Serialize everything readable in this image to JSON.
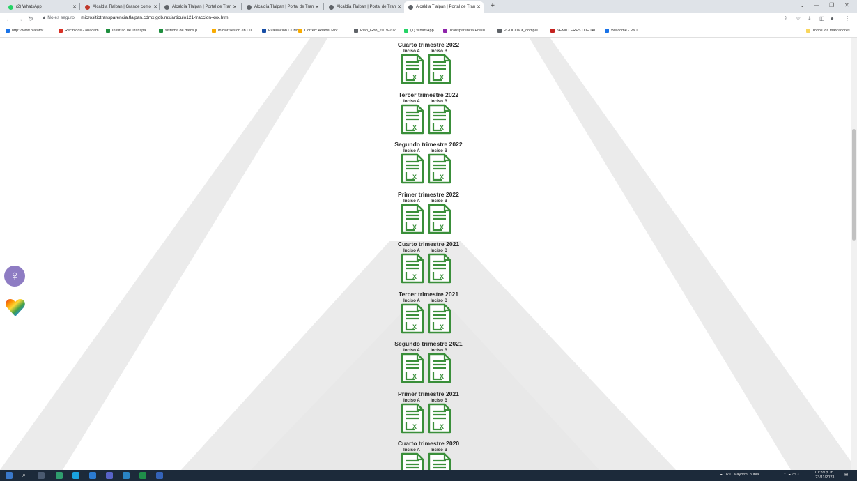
{
  "browser": {
    "tabs": [
      {
        "label": "(2) WhatsApp",
        "color": "#25d366",
        "active": false
      },
      {
        "label": "Alcaldía Tlalpan | Grande como",
        "color": "#c0392b",
        "active": false
      },
      {
        "label": "Alcaldía Tlalpan | Portal de Tran",
        "color": "#5f6368",
        "active": false
      },
      {
        "label": "Alcaldía Tlalpan | Portal de Tran",
        "color": "#5f6368",
        "active": false
      },
      {
        "label": "Alcaldía Tlalpan | Portal de Tran",
        "color": "#5f6368",
        "active": false
      },
      {
        "label": "Alcaldía Tlalpan | Portal de Tran",
        "color": "#5f6368",
        "active": true
      }
    ],
    "new_tab": "+",
    "security": "No es seguro",
    "url": "micrositiotransparencia.tlalpan.cdmx.gob.mx/articulo121-fraccion-xxx.html",
    "bookmarks": [
      {
        "label": "http://www.platafor...",
        "color": "#1a73e8"
      },
      {
        "label": "Recibidos - anacam...",
        "color": "#d93025"
      },
      {
        "label": "Instituto de Transpa...",
        "color": "#1e8e3e"
      },
      {
        "label": "sistema de datos p...",
        "color": "#1e8e3e"
      },
      {
        "label": "Iniciar sesión en Cu...",
        "color": "#f9ab00"
      },
      {
        "label": "Evaluación CDMx",
        "color": "#174ea6"
      },
      {
        "label": "Correo: Anabel Mor...",
        "color": "#f9ab00"
      },
      {
        "label": "Plan_Gob_2019-202...",
        "color": "#5f6368"
      },
      {
        "label": "(1) WhatsApp",
        "color": "#25d366"
      },
      {
        "label": "Transparencia Presu...",
        "color": "#8e24aa"
      },
      {
        "label": "PGDCDMX_comple...",
        "color": "#5f6368"
      },
      {
        "label": "SEMILLERES DIGITAL",
        "color": "#c5221f"
      },
      {
        "label": "Welcome - PNT",
        "color": "#1a73e8"
      }
    ],
    "all_bookmarks": "Todos los marcadores"
  },
  "page": {
    "groups": [
      {
        "title": "Cuarto trimestre 2022",
        "inciso_a": "Inciso A",
        "inciso_b": "Inciso B"
      },
      {
        "title": "Tercer trimestre 2022",
        "inciso_a": "Inciso A",
        "inciso_b": "Inciso B"
      },
      {
        "title": "Segundo trimestre 2022",
        "inciso_a": "Inciso A",
        "inciso_b": "Inciso B"
      },
      {
        "title": "Primer trimestre 2022",
        "inciso_a": "Inciso A",
        "inciso_b": "Inciso B"
      },
      {
        "title": "Cuarto trimestre 2021",
        "inciso_a": "Inciso A",
        "inciso_b": "Inciso B"
      },
      {
        "title": "Tercer trimestre 2021",
        "inciso_a": "Inciso A",
        "inciso_b": "Inciso B"
      },
      {
        "title": "Segundo trimestre 2021",
        "inciso_a": "Inciso A",
        "inciso_b": "Inciso B"
      },
      {
        "title": "Primer trimestre 2021",
        "inciso_a": "Inciso A",
        "inciso_b": "Inciso B"
      },
      {
        "title": "Cuarto trimestre 2020",
        "inciso_a": "Inciso A",
        "inciso_b": "Inciso B"
      }
    ],
    "file_icon": "excel-file-icon",
    "icon_color": "#3a8f3a",
    "side_icons": [
      "venus-symbol-icon",
      "rainbow-heart-icon"
    ]
  },
  "taskbar": {
    "weather": "16°C Mayorm. nubla...",
    "time": "01:39 p. m.",
    "date": "23/11/2023"
  }
}
